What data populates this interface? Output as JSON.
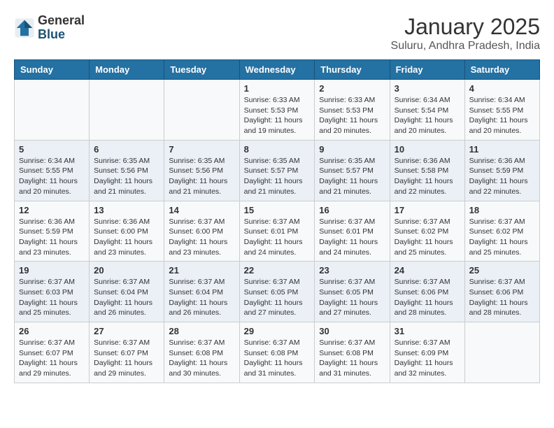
{
  "header": {
    "logo_general": "General",
    "logo_blue": "Blue",
    "title": "January 2025",
    "subtitle": "Suluru, Andhra Pradesh, India"
  },
  "weekdays": [
    "Sunday",
    "Monday",
    "Tuesday",
    "Wednesday",
    "Thursday",
    "Friday",
    "Saturday"
  ],
  "weeks": [
    [
      {
        "day": "",
        "info": ""
      },
      {
        "day": "",
        "info": ""
      },
      {
        "day": "",
        "info": ""
      },
      {
        "day": "1",
        "info": "Sunrise: 6:33 AM\nSunset: 5:53 PM\nDaylight: 11 hours and 19 minutes."
      },
      {
        "day": "2",
        "info": "Sunrise: 6:33 AM\nSunset: 5:53 PM\nDaylight: 11 hours and 20 minutes."
      },
      {
        "day": "3",
        "info": "Sunrise: 6:34 AM\nSunset: 5:54 PM\nDaylight: 11 hours and 20 minutes."
      },
      {
        "day": "4",
        "info": "Sunrise: 6:34 AM\nSunset: 5:55 PM\nDaylight: 11 hours and 20 minutes."
      }
    ],
    [
      {
        "day": "5",
        "info": "Sunrise: 6:34 AM\nSunset: 5:55 PM\nDaylight: 11 hours and 20 minutes."
      },
      {
        "day": "6",
        "info": "Sunrise: 6:35 AM\nSunset: 5:56 PM\nDaylight: 11 hours and 21 minutes."
      },
      {
        "day": "7",
        "info": "Sunrise: 6:35 AM\nSunset: 5:56 PM\nDaylight: 11 hours and 21 minutes."
      },
      {
        "day": "8",
        "info": "Sunrise: 6:35 AM\nSunset: 5:57 PM\nDaylight: 11 hours and 21 minutes."
      },
      {
        "day": "9",
        "info": "Sunrise: 6:35 AM\nSunset: 5:57 PM\nDaylight: 11 hours and 21 minutes."
      },
      {
        "day": "10",
        "info": "Sunrise: 6:36 AM\nSunset: 5:58 PM\nDaylight: 11 hours and 22 minutes."
      },
      {
        "day": "11",
        "info": "Sunrise: 6:36 AM\nSunset: 5:59 PM\nDaylight: 11 hours and 22 minutes."
      }
    ],
    [
      {
        "day": "12",
        "info": "Sunrise: 6:36 AM\nSunset: 5:59 PM\nDaylight: 11 hours and 23 minutes."
      },
      {
        "day": "13",
        "info": "Sunrise: 6:36 AM\nSunset: 6:00 PM\nDaylight: 11 hours and 23 minutes."
      },
      {
        "day": "14",
        "info": "Sunrise: 6:37 AM\nSunset: 6:00 PM\nDaylight: 11 hours and 23 minutes."
      },
      {
        "day": "15",
        "info": "Sunrise: 6:37 AM\nSunset: 6:01 PM\nDaylight: 11 hours and 24 minutes."
      },
      {
        "day": "16",
        "info": "Sunrise: 6:37 AM\nSunset: 6:01 PM\nDaylight: 11 hours and 24 minutes."
      },
      {
        "day": "17",
        "info": "Sunrise: 6:37 AM\nSunset: 6:02 PM\nDaylight: 11 hours and 25 minutes."
      },
      {
        "day": "18",
        "info": "Sunrise: 6:37 AM\nSunset: 6:02 PM\nDaylight: 11 hours and 25 minutes."
      }
    ],
    [
      {
        "day": "19",
        "info": "Sunrise: 6:37 AM\nSunset: 6:03 PM\nDaylight: 11 hours and 25 minutes."
      },
      {
        "day": "20",
        "info": "Sunrise: 6:37 AM\nSunset: 6:04 PM\nDaylight: 11 hours and 26 minutes."
      },
      {
        "day": "21",
        "info": "Sunrise: 6:37 AM\nSunset: 6:04 PM\nDaylight: 11 hours and 26 minutes."
      },
      {
        "day": "22",
        "info": "Sunrise: 6:37 AM\nSunset: 6:05 PM\nDaylight: 11 hours and 27 minutes."
      },
      {
        "day": "23",
        "info": "Sunrise: 6:37 AM\nSunset: 6:05 PM\nDaylight: 11 hours and 27 minutes."
      },
      {
        "day": "24",
        "info": "Sunrise: 6:37 AM\nSunset: 6:06 PM\nDaylight: 11 hours and 28 minutes."
      },
      {
        "day": "25",
        "info": "Sunrise: 6:37 AM\nSunset: 6:06 PM\nDaylight: 11 hours and 28 minutes."
      }
    ],
    [
      {
        "day": "26",
        "info": "Sunrise: 6:37 AM\nSunset: 6:07 PM\nDaylight: 11 hours and 29 minutes."
      },
      {
        "day": "27",
        "info": "Sunrise: 6:37 AM\nSunset: 6:07 PM\nDaylight: 11 hours and 29 minutes."
      },
      {
        "day": "28",
        "info": "Sunrise: 6:37 AM\nSunset: 6:08 PM\nDaylight: 11 hours and 30 minutes."
      },
      {
        "day": "29",
        "info": "Sunrise: 6:37 AM\nSunset: 6:08 PM\nDaylight: 11 hours and 31 minutes."
      },
      {
        "day": "30",
        "info": "Sunrise: 6:37 AM\nSunset: 6:08 PM\nDaylight: 11 hours and 31 minutes."
      },
      {
        "day": "31",
        "info": "Sunrise: 6:37 AM\nSunset: 6:09 PM\nDaylight: 11 hours and 32 minutes."
      },
      {
        "day": "",
        "info": ""
      }
    ]
  ]
}
